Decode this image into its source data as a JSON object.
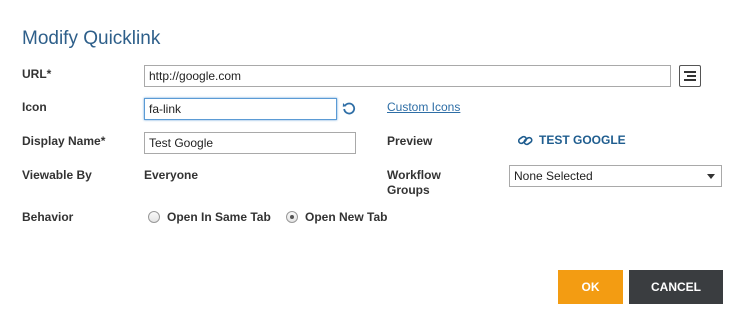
{
  "dialog": {
    "title": "Modify Quicklink"
  },
  "form": {
    "url": {
      "label": "URL*",
      "value": "http://google.com",
      "picker_icon": "list-icon"
    },
    "icon": {
      "label": "Icon",
      "value": "fa-link",
      "reset_icon": "refresh-icon",
      "custom_link": "Custom Icons"
    },
    "display_name": {
      "label": "Display Name*",
      "value": "Test Google"
    },
    "preview": {
      "label": "Preview",
      "text": "TEST GOOGLE",
      "icon": "link-icon"
    },
    "viewable_by": {
      "label": "Viewable By",
      "value": "Everyone"
    },
    "workflow_groups": {
      "label_line1": "Workflow",
      "label_line2": "Groups",
      "selected": "None Selected"
    },
    "behavior": {
      "label": "Behavior",
      "options": [
        {
          "label": "Open In Same Tab",
          "selected": false
        },
        {
          "label": "Open New Tab",
          "selected": true
        }
      ]
    }
  },
  "buttons": {
    "ok": "OK",
    "cancel": "CANCEL"
  },
  "colors": {
    "title": "#2e5f8a",
    "ok": "#f39c12",
    "cancel": "#3a3d40",
    "link": "#2e6ea6"
  }
}
